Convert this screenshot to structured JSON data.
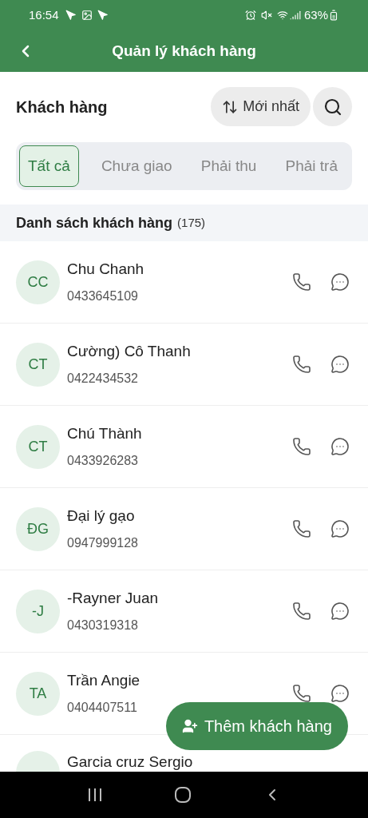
{
  "status_bar": {
    "time": "16:54",
    "battery": "63%"
  },
  "header": {
    "title": "Quản lý khách hàng"
  },
  "section": {
    "title": "Khách hàng",
    "sort": "Mới nhất"
  },
  "tabs": [
    {
      "label": "Tất cả",
      "selected": true
    },
    {
      "label": "Chưa giao",
      "selected": false
    },
    {
      "label": "Phải thu",
      "selected": false
    },
    {
      "label": "Phải trả",
      "selected": false
    }
  ],
  "list": {
    "title": "Danh sách khách hàng",
    "count": "(175)"
  },
  "customers": [
    {
      "initials": "CC",
      "name": "Chu Chanh",
      "phone": "0433645109"
    },
    {
      "initials": "CT",
      "name": "Cường) Cô Thanh",
      "phone": "0422434532"
    },
    {
      "initials": "CT",
      "name": "Chú Thành",
      "phone": "0433926283"
    },
    {
      "initials": "ĐG",
      "name": "Đại lý gạo",
      "phone": "0947999128"
    },
    {
      "initials": "-J",
      "name": "-Rayner Juan",
      "phone": "0430319318"
    },
    {
      "initials": "TA",
      "name": "Trần Angie",
      "phone": "0404407511"
    },
    {
      "name": "Garcia cruz Sergio"
    }
  ],
  "add_button": "Thêm khách hàng"
}
